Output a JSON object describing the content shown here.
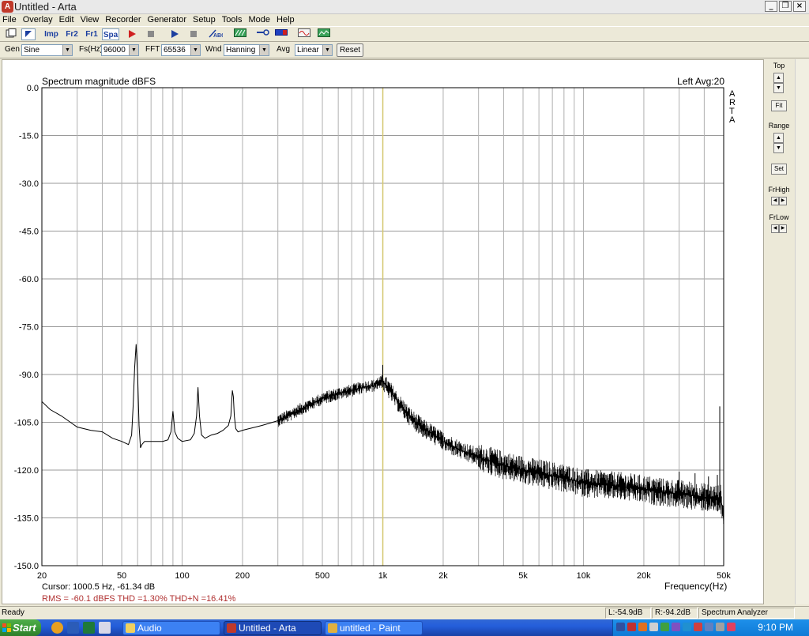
{
  "window": {
    "title": "Untitled - Arta",
    "controls": [
      "_",
      "❐",
      "×"
    ]
  },
  "menu": [
    "File",
    "Overlay",
    "Edit",
    "View",
    "Recorder",
    "Generator",
    "Setup",
    "Tools",
    "Mode",
    "Help"
  ],
  "toolbar": {
    "imp": "Imp",
    "fr2": "Fr2",
    "fr1": "Fr1",
    "spa": "Spa"
  },
  "combos": {
    "gen_label": "Gen",
    "gen_value": "Sine",
    "fs_label": "Fs(Hz)",
    "fs_value": "96000",
    "fft_label": "FFT",
    "fft_value": "65536",
    "wnd_label": "Wnd",
    "wnd_value": "Hanning",
    "avg_label": "Avg",
    "avg_value": "Linear",
    "reset": "Reset"
  },
  "plot": {
    "title": "Spectrum magnitude dBFS",
    "top_right": "Left  Avg:20",
    "brand": "ARTA",
    "cursor": "Cursor:  1000.5 Hz, -61.34 dB",
    "stats": "RMS =  -60.1 dBFS   THD =1.30%   THD+N =16.41%",
    "cursor_color": "#d4c770",
    "stats_color": "#b03030"
  },
  "side": {
    "top": "Top",
    "fit": "Fit",
    "range": "Range",
    "set": "Set",
    "frhigh": "FrHigh",
    "frlow": "FrLow"
  },
  "status": {
    "ready": "Ready",
    "left": "L:-54.9dB",
    "right": "R:-94.2dB",
    "mode": "Spectrum Analyzer"
  },
  "taskbar": {
    "start": "Start",
    "items": [
      "Audio",
      "Untitled - Arta",
      "untitled - Paint"
    ],
    "clock": "9:10 PM"
  },
  "chart_data": {
    "type": "line",
    "title": "Spectrum magnitude dBFS",
    "xlabel": "Frequency(Hz)",
    "ylabel": "",
    "xscale": "log",
    "xlim": [
      20,
      50000
    ],
    "ylim": [
      -150,
      0
    ],
    "grid": true,
    "yticks": [
      "0.0",
      "-15.0",
      "-30.0",
      "-45.0",
      "-60.0",
      "-75.0",
      "-90.0",
      "-105.0",
      "-120.0",
      "-135.0",
      "-150.0"
    ],
    "ytick_values": [
      0,
      -15,
      -30,
      -45,
      -60,
      -75,
      -90,
      -105,
      -120,
      -135,
      -150
    ],
    "xticks": [
      "20",
      "50",
      "100",
      "200",
      "500",
      "1k",
      "2k",
      "5k",
      "10k",
      "20k",
      "50k"
    ],
    "xtick_values": [
      20,
      50,
      100,
      200,
      500,
      1000,
      2000,
      5000,
      10000,
      20000,
      50000
    ],
    "cursor_hz": 1000.5,
    "series": [
      {
        "x": [
          20,
          22,
          25,
          30,
          35,
          40,
          45,
          50,
          54,
          56,
          57,
          58,
          59,
          60,
          61,
          62,
          63,
          65,
          70,
          75,
          80,
          85,
          88,
          90,
          92,
          95,
          100,
          110,
          115,
          118,
          120,
          122,
          125,
          130,
          140,
          150,
          160,
          170,
          175,
          178,
          180,
          182,
          185,
          190,
          200,
          250,
          300,
          350,
          400,
          450,
          500,
          600,
          700,
          800,
          900,
          950,
          980,
          1000,
          1020,
          1050,
          1100,
          1200,
          1400,
          1600,
          1800,
          2000,
          2500,
          3000,
          4000,
          5000,
          6000,
          8000,
          10000,
          12000,
          15000,
          20000,
          25000,
          30000,
          35000,
          40000,
          45000,
          47000,
          48000,
          48500,
          49000,
          49500,
          50000
        ],
        "y": [
          -98.5,
          -101,
          -103,
          -106.5,
          -107.5,
          -108,
          -110,
          -111,
          -112,
          -109,
          -100,
          -88,
          -80.5,
          -90,
          -106,
          -113,
          -112,
          -111,
          -111,
          -111,
          -111,
          -110.5,
          -108,
          -101.5,
          -108,
          -110,
          -111,
          -110.5,
          -108.5,
          -103,
          -94,
          -103,
          -109,
          -110,
          -109,
          -108.5,
          -107.5,
          -106,
          -103,
          -95,
          -97,
          -103,
          -107,
          -108,
          -107.5,
          -106,
          -104.5,
          -102.5,
          -100.5,
          -99,
          -97.5,
          -96,
          -95,
          -94,
          -93.5,
          -92.5,
          -92.5,
          -92,
          -93,
          -94,
          -95.5,
          -99,
          -104,
          -107,
          -109,
          -111,
          -114,
          -116,
          -118.5,
          -120,
          -121,
          -122.5,
          -124,
          -124.5,
          -125,
          -126,
          -127,
          -127.5,
          -128,
          -128.5,
          -129,
          -129,
          -128,
          -130,
          -131,
          -133,
          -136
        ]
      }
    ],
    "spikes": [
      {
        "x": 1000,
        "top": -87
      },
      {
        "x": 47800,
        "top": -100
      },
      {
        "x": 46500,
        "top": -121.5
      },
      {
        "x": 42000,
        "top": -122
      },
      {
        "x": 36000,
        "top": -121
      },
      {
        "x": 30000,
        "top": -120.5
      },
      {
        "x": 24000,
        "top": -122.5
      },
      {
        "x": 18000,
        "top": -122
      },
      {
        "x": 13500,
        "top": -122.5
      }
    ]
  }
}
